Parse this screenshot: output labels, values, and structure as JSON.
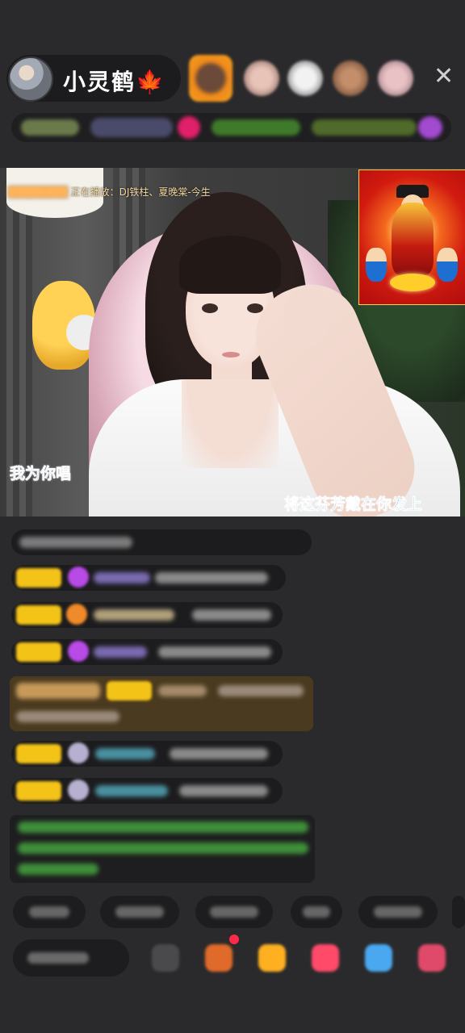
{
  "header": {
    "host_name": "小灵鹤",
    "host_name_icon": "maple-leaf-icon",
    "close_icon": "close-icon"
  },
  "video": {
    "song_prefix": "",
    "song_now_playing": "正在播放：DJ铁柱、夏晚棠-今生",
    "caption_left": "我为你唱",
    "caption_right": "将这芬芳戴在你发上"
  },
  "bottom": {
    "icons": [
      "chat-icon",
      "gift-box-icon",
      "gift-icon",
      "red-packet-icon",
      "game-icon",
      "more-icon"
    ]
  },
  "colors": {
    "background": "#2a2a2c",
    "badge": "#f4c318",
    "caption": "#1e8ed8"
  }
}
